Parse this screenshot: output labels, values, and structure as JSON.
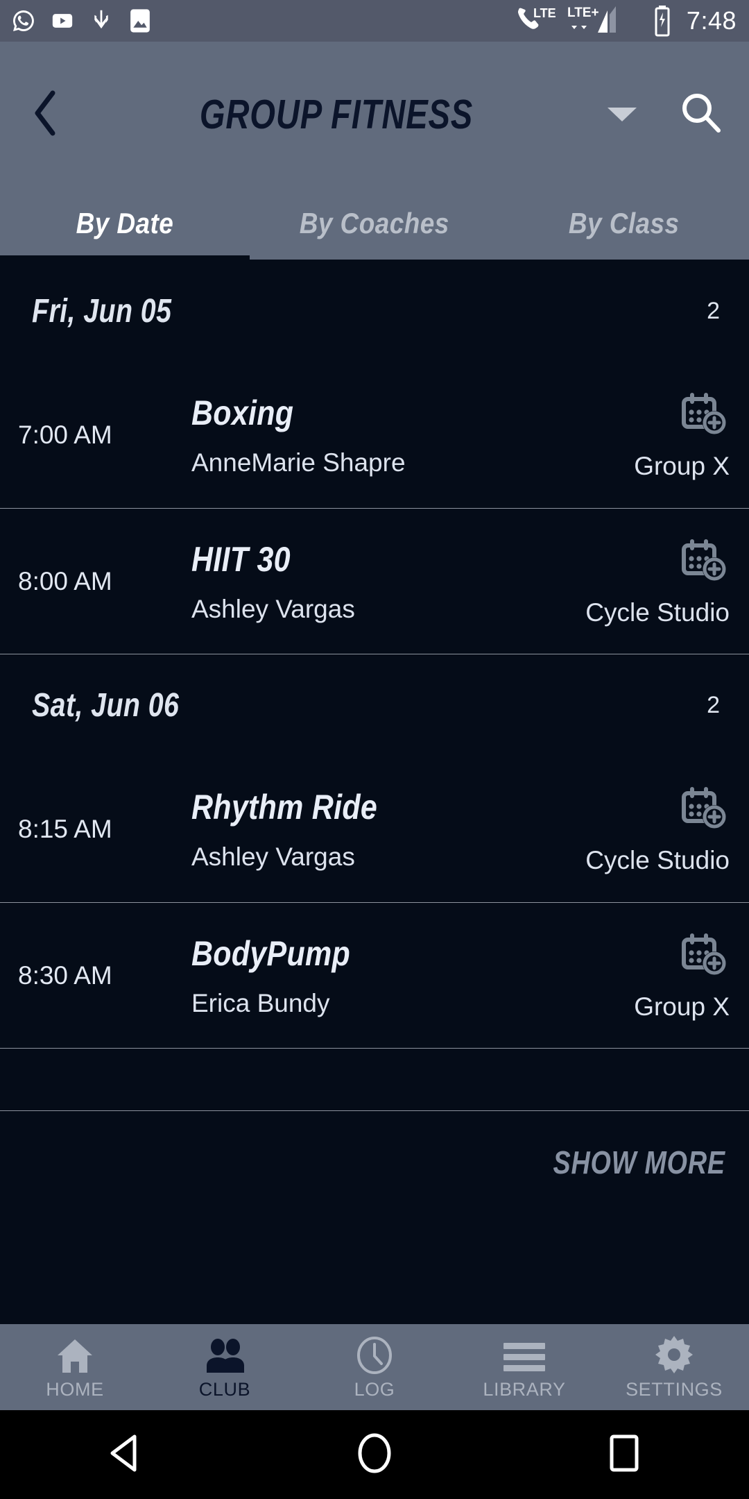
{
  "statusbar": {
    "icons": [
      "whatsapp-icon",
      "youtube-icon",
      "download-icon",
      "photos-icon"
    ],
    "call_label": "LTE",
    "signal_label": "LTE+",
    "time": "7:48"
  },
  "header": {
    "back_icon": "chevron-left-icon",
    "title": "GROUP FITNESS",
    "dropdown_icon": "caret-down-icon",
    "search_icon": "search-icon"
  },
  "tabs": [
    {
      "label": "By Date",
      "active": true
    },
    {
      "label": "By Coaches",
      "active": false
    },
    {
      "label": "By Class",
      "active": false
    }
  ],
  "groups": [
    {
      "date": "Fri, Jun 05",
      "count": "2",
      "classes": [
        {
          "time": "7:00 AM",
          "name": "Boxing",
          "coach": "AnneMarie Shapre",
          "location": "Group X",
          "action_icon": "calendar-add-icon"
        },
        {
          "time": "8:00 AM",
          "name": "HIIT 30",
          "coach": "Ashley Vargas",
          "location": "Cycle Studio",
          "action_icon": "calendar-add-icon"
        }
      ]
    },
    {
      "date": "Sat, Jun 06",
      "count": "2",
      "classes": [
        {
          "time": "8:15 AM",
          "name": "Rhythm Ride",
          "coach": "Ashley Vargas",
          "location": "Cycle Studio",
          "action_icon": "calendar-add-icon"
        },
        {
          "time": "8:30 AM",
          "name": "BodyPump",
          "coach": "Erica Bundy",
          "location": "Group X",
          "action_icon": "calendar-add-icon"
        }
      ]
    }
  ],
  "show_more": {
    "label": "SHOW MORE"
  },
  "bottomnav": [
    {
      "label": "HOME",
      "icon": "home-icon",
      "active": false
    },
    {
      "label": "CLUB",
      "icon": "people-icon",
      "active": true
    },
    {
      "label": "LOG",
      "icon": "clock-icon",
      "active": false
    },
    {
      "label": "LIBRARY",
      "icon": "menu-icon",
      "active": false
    },
    {
      "label": "SETTINGS",
      "icon": "gear-icon",
      "active": false
    }
  ],
  "sysnav": [
    {
      "icon": "android-back-icon"
    },
    {
      "icon": "android-home-icon"
    },
    {
      "icon": "android-recents-icon"
    }
  ],
  "colors": {
    "chrome": "#616b7d",
    "statusbar": "#53596a",
    "content_bg": "#050c18",
    "accent_dark": "#0b142a",
    "text_primary": "#e2e8f2",
    "text_muted": "#8892a3",
    "divider": "#8d939e",
    "icon_gray": "#7b8694"
  }
}
